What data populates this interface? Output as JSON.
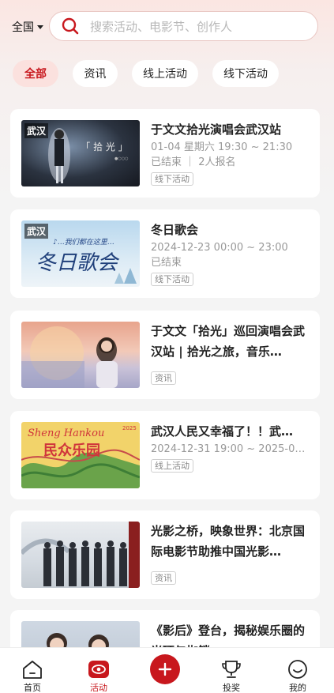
{
  "header": {
    "region": "全国",
    "search_placeholder": "搜索活动、电影节、创作人"
  },
  "chips": [
    "全部",
    "资讯",
    "线上活动",
    "线下活动"
  ],
  "cards": [
    {
      "city": "武汉",
      "title": "于文文拾光演唱会武汉站",
      "meta1": "01-04 星期六 19:30 ~ 21:30",
      "meta2": "已结束 ｜ 2人报名",
      "tag": "线下活动"
    },
    {
      "city": "武汉",
      "title": "冬日歌会",
      "meta1": "2024-12-23 00:00 ~ 23:00",
      "meta2": "已结束",
      "tag": "线下活动"
    },
    {
      "title": "于文文「拾光」巡回演唱会武汉站 | 拾光之旅，音乐…",
      "tag": "资讯"
    },
    {
      "title": "武汉人民又幸福了！！武…",
      "meta1": "2024-12-31 19:00 ~ 2025-01…",
      "tag": "线上活动"
    },
    {
      "title": "光影之桥，映象世界：北京国际电影节助推中国光影…",
      "tag": "资讯"
    },
    {
      "title": "《影后》登台，揭秘娱乐圈的光环与枷锁"
    }
  ],
  "tabbar": {
    "home": "首页",
    "activity": "活动",
    "vote": "投奖",
    "mine": "我的"
  },
  "colors": {
    "accent": "#c8171d"
  }
}
